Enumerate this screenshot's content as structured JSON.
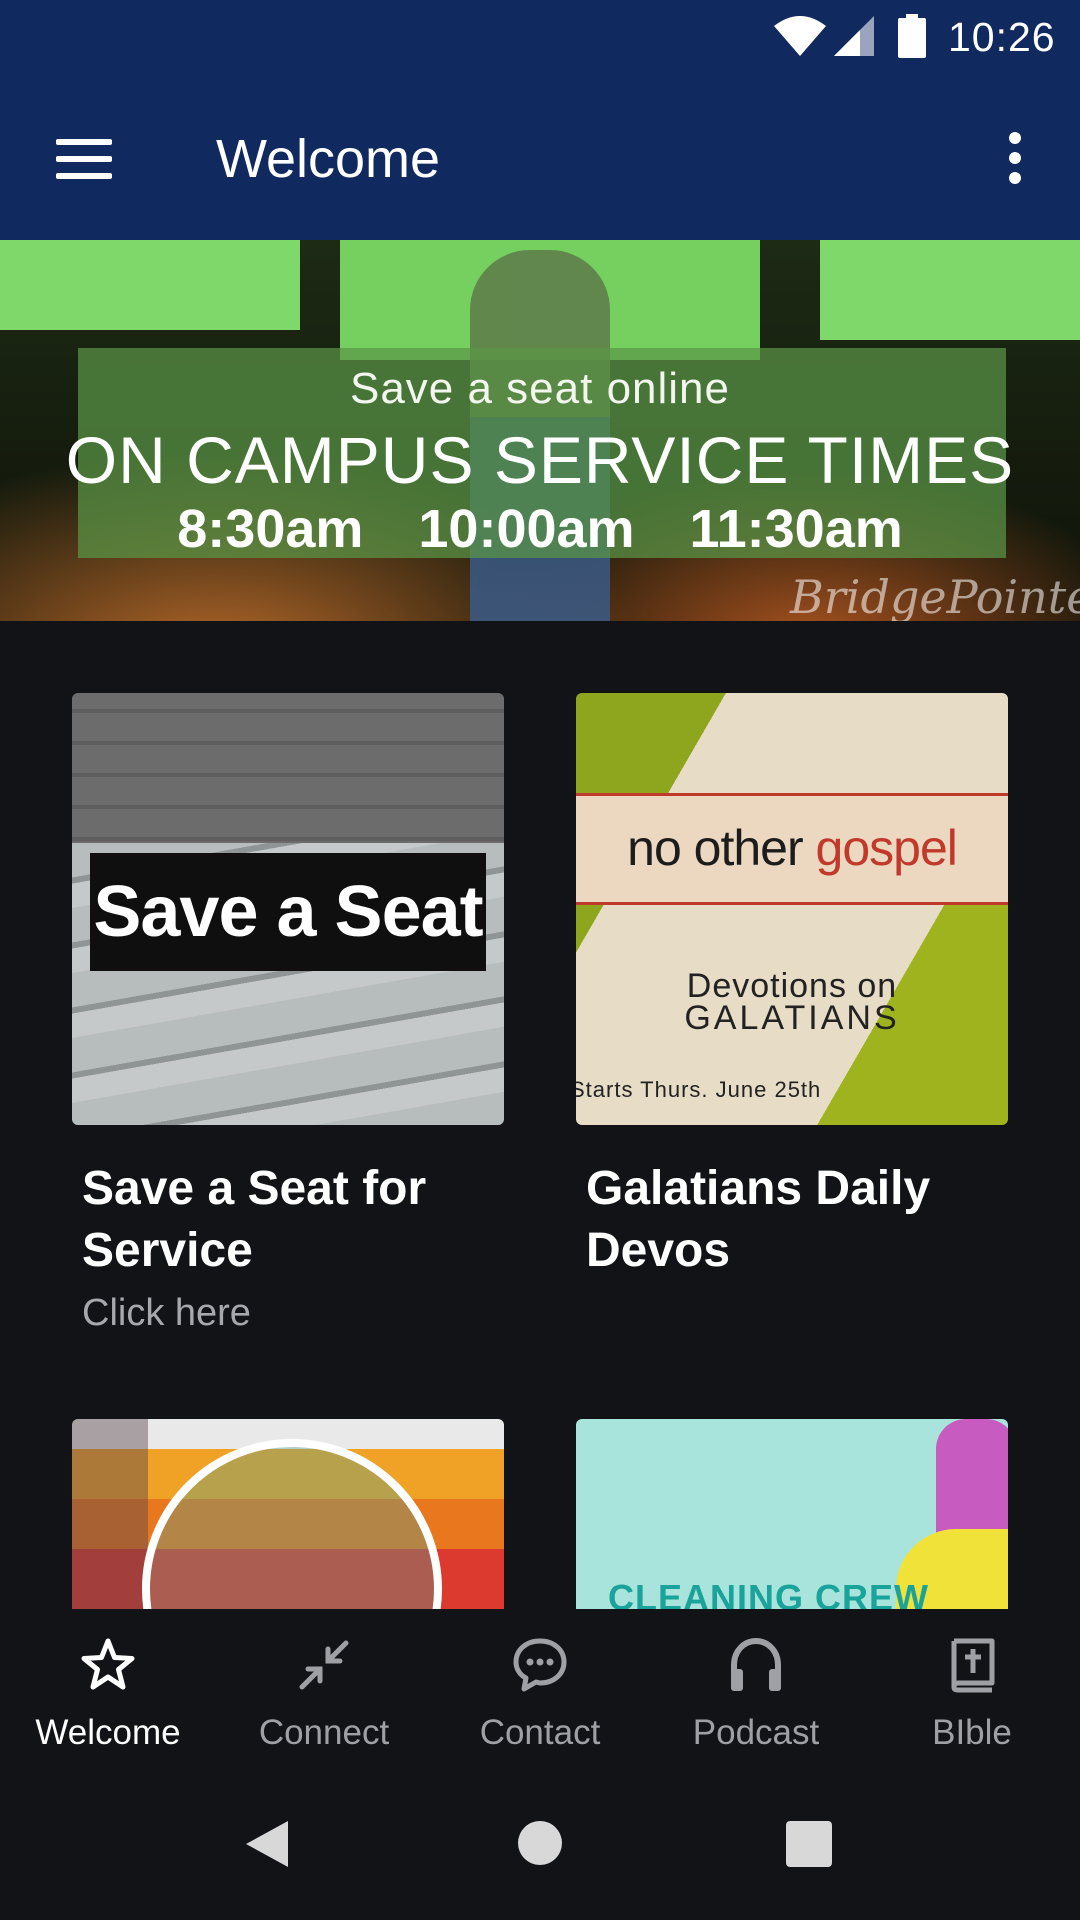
{
  "status_bar": {
    "time": "10:26"
  },
  "app_bar": {
    "title": "Welcome"
  },
  "hero": {
    "line1": "Save a seat online",
    "line2": "ON CAMPUS SERVICE TIMES",
    "line3": "8:30am 10:00am 11:30am",
    "signature": "BridgePointe"
  },
  "cards": [
    {
      "image_text": "Save a Seat",
      "title": "Save a Seat for Service",
      "subtitle": "Click here"
    },
    {
      "image_text_dark": "no other ",
      "image_text_red": "gospel",
      "devo_line1": "Devotions on",
      "devo_line2": "GALATIANS",
      "starts": "Starts Thurs. June 25th",
      "title": "Galatians Daily Devos"
    },
    {
      "image_text": ""
    },
    {
      "image_text": "CLEANING CREW"
    }
  ],
  "bottom_nav": {
    "items": [
      {
        "label": "Welcome",
        "icon": "star-icon",
        "active": true
      },
      {
        "label": "Connect",
        "icon": "connect-arrows-icon",
        "active": false
      },
      {
        "label": "Contact",
        "icon": "chat-bubble-icon",
        "active": false
      },
      {
        "label": "Podcast",
        "icon": "headphones-icon",
        "active": false
      },
      {
        "label": "BIble",
        "icon": "bible-icon",
        "active": false
      }
    ]
  },
  "colors": {
    "app_bar": "#10295f",
    "background": "#121316",
    "nav_inactive": "#9ea0a5",
    "nav_active": "#ffffff"
  }
}
